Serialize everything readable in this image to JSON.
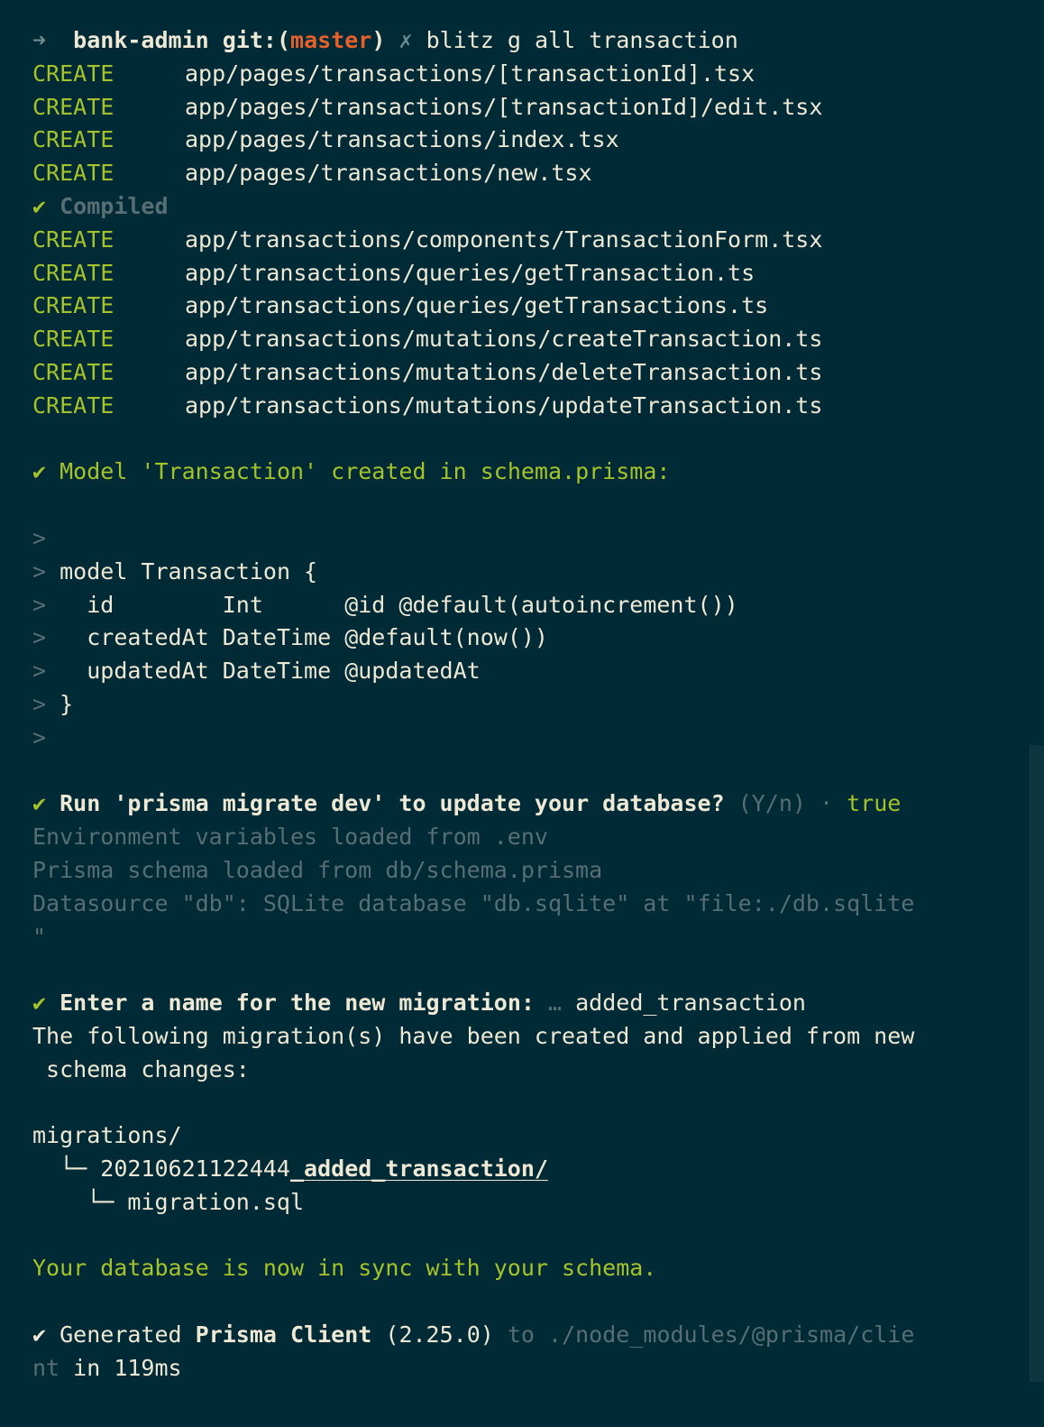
{
  "prompt": {
    "arrow": "➜",
    "directory": "bank-admin",
    "git_prefix": "git:(",
    "branch": "master",
    "git_suffix": ")",
    "dirty_marker": "✗",
    "command": "blitz g all transaction"
  },
  "create_label": "CREATE",
  "check": "✔",
  "pages_files": [
    "app/pages/transactions/[transactionId].tsx",
    "app/pages/transactions/[transactionId]/edit.tsx",
    "app/pages/transactions/index.tsx",
    "app/pages/transactions/new.tsx"
  ],
  "compiled_text": "Compiled",
  "app_files": [
    "app/transactions/components/TransactionForm.tsx",
    "app/transactions/queries/getTransaction.ts",
    "app/transactions/queries/getTransactions.ts",
    "app/transactions/mutations/createTransaction.ts",
    "app/transactions/mutations/deleteTransaction.ts",
    "app/transactions/mutations/updateTransaction.ts"
  ],
  "model_created_text": "Model 'Transaction' created in schema.prisma:",
  "quote_marker": ">",
  "model_lines": [
    "model Transaction {",
    "  id        Int      @id @default(autoincrement())",
    "  createdAt DateTime @default(now())",
    "  updatedAt DateTime @updatedAt",
    "}"
  ],
  "migrate_question": "Run 'prisma migrate dev' to update your database?",
  "migrate_hint": "(Y/n)",
  "migrate_separator": "·",
  "migrate_answer": "true",
  "env_lines": [
    "Environment variables loaded from .env",
    "Prisma schema loaded from db/schema.prisma",
    "Datasource \"db\": SQLite database \"db.sqlite\" at \"file:./db.sqlite",
    "\""
  ],
  "name_question": "Enter a name for the new migration:",
  "name_ellipsis": "…",
  "name_answer": "added_transaction",
  "applied_lines": [
    "The following migration(s) have been created and applied from new",
    " schema changes:"
  ],
  "tree": {
    "root": "migrations/",
    "branch1": "  └─ ",
    "folder_timestamp": "20210621122444",
    "folder_name": "_added_transaction/",
    "branch2": "    └─ ",
    "file": "migration.sql"
  },
  "sync_text": "Your database is now in sync with your schema.",
  "generated": {
    "prefix": "Generated",
    "client": "Prisma Client",
    "version": "(2.25.0)",
    "path1": "to ./node_modules/@prisma/clie",
    "path2": "nt",
    "time": "in 119ms"
  },
  "colors": {
    "background": "#002b36",
    "green": "#a6c22a",
    "branch_orange": "#e4612b",
    "muted": "#6f8990",
    "text": "#eee8d5"
  }
}
